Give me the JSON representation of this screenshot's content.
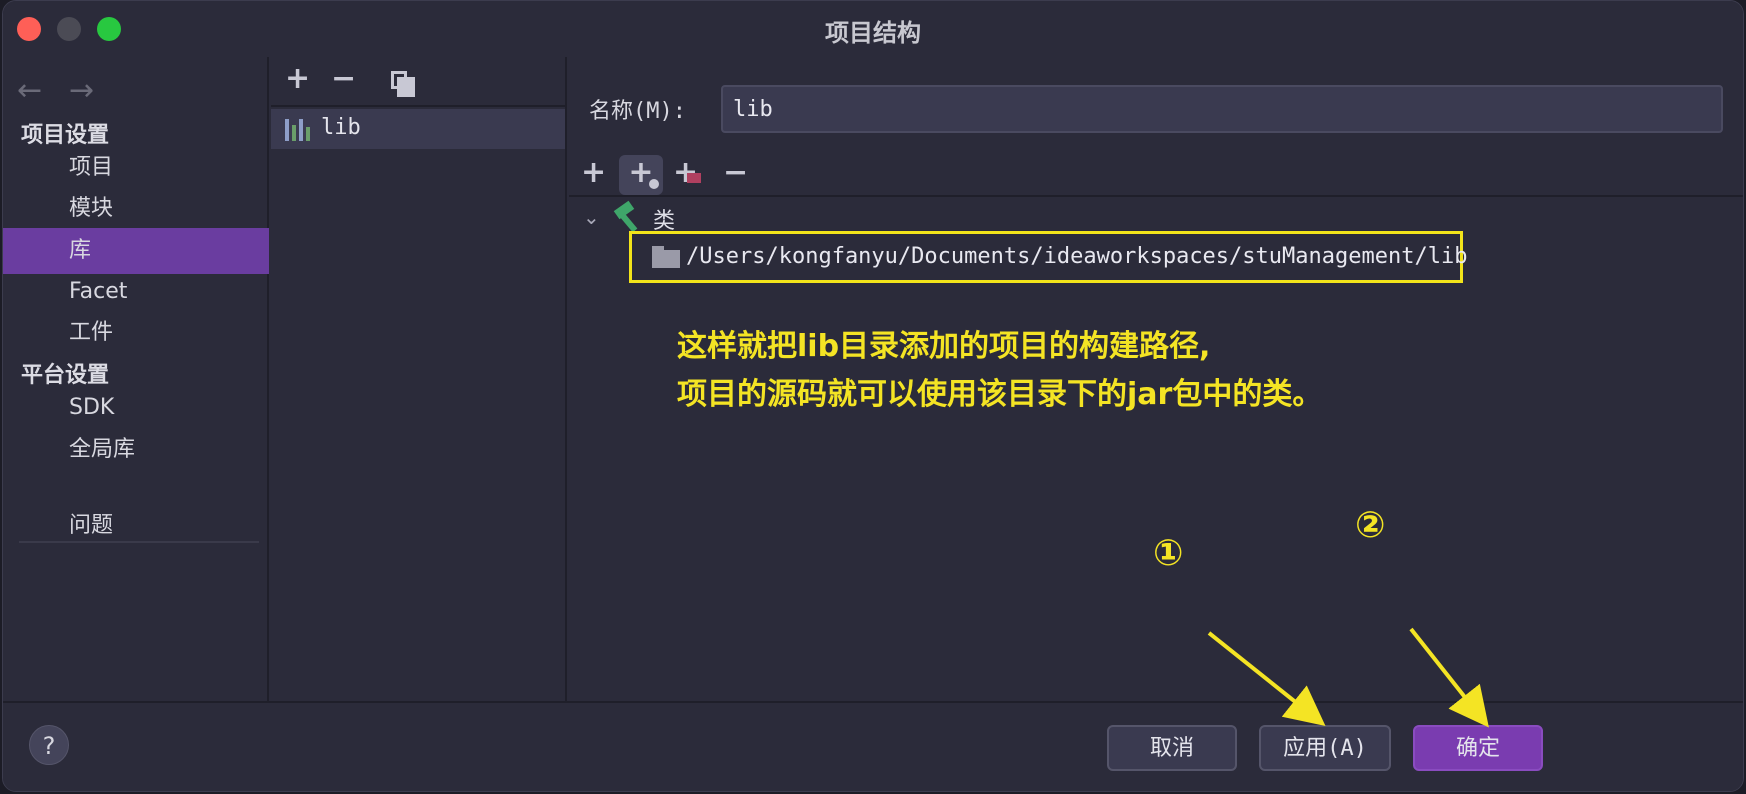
{
  "window": {
    "title": "项目结构",
    "controls": [
      "close",
      "minimize",
      "maximize"
    ]
  },
  "nav": {
    "back_icon": "←",
    "forward_icon": "→",
    "sections": [
      {
        "label": "项目设置"
      },
      {
        "label": "平台设置"
      }
    ],
    "items": [
      {
        "label": "项目"
      },
      {
        "label": "模块"
      },
      {
        "label": "库",
        "selected": true
      },
      {
        "label": "Facet"
      },
      {
        "label": "工件"
      },
      {
        "label": "SDK"
      },
      {
        "label": "全局库"
      },
      {
        "label": "问题"
      }
    ]
  },
  "midcol": {
    "toolbar": {
      "add": "+",
      "remove": "−"
    },
    "list": [
      {
        "label": "lib"
      }
    ]
  },
  "detail": {
    "name_label": "名称(M):",
    "name_value": "lib",
    "toolbar": {
      "add": "+",
      "add_url": "+",
      "add_folder": "+",
      "remove": "−"
    },
    "tree": {
      "category_label": "类",
      "path": "/Users/kongfanyu/Documents/ideaworkspaces/stuManagement/lib"
    }
  },
  "annotation": {
    "line1": "这样就把lib目录添加的项目的构建路径,",
    "line2": "项目的源码就可以使用该目录下的jar包中的类。",
    "marker1": "①",
    "marker2": "②",
    "color": "#f4e424"
  },
  "footer": {
    "help": "?",
    "cancel": "取消",
    "apply": "应用(A)",
    "ok": "确定"
  },
  "colors": {
    "accent": "#6a3da0",
    "primary_button": "#7a3cb0",
    "highlight_box": "#f2e41a"
  }
}
